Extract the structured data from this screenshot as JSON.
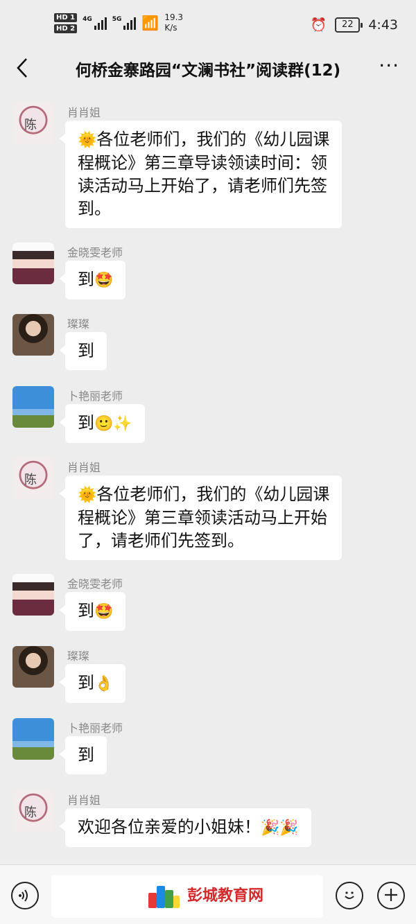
{
  "status_bar": {
    "hd1": "HD 1",
    "hd2": "HD 2",
    "sim1_label": "4G",
    "sim2_label": "5G",
    "speed_value": "19.3",
    "speed_unit": "K/s",
    "battery": "22",
    "time": "4:43"
  },
  "header": {
    "back_icon": "<",
    "title": "何桥金寨路园“文澜书社”阅读群(12)",
    "more_icon": "···"
  },
  "messages": [
    {
      "sender": "肖肖姐",
      "avatar": "xiao",
      "text": "各位老师们，我们的《幼儿园课程概论》第三章导读领读时间：领读活动马上开始了，请老师们先签到。",
      "lines": [
        "各位老师们，我们的《幼儿园课",
        "程概论》第三章导读领读时间：领",
        "读活动马上开始了，请老师们先签",
        "到。"
      ],
      "lead_emoji": "🌞",
      "trail_emoji": ""
    },
    {
      "sender": "金晓雯老师",
      "avatar": "jin",
      "lines": [
        "到"
      ],
      "lead_emoji": "",
      "trail_emoji": "🤩"
    },
    {
      "sender": "璨璨",
      "avatar": "can",
      "lines": [
        "到"
      ],
      "lead_emoji": "",
      "trail_emoji": ""
    },
    {
      "sender": "卜艳丽老师",
      "avatar": "bu",
      "lines": [
        "到"
      ],
      "lead_emoji": "",
      "trail_emoji": "🙂✨"
    },
    {
      "sender": "肖肖姐",
      "avatar": "xiao",
      "lines": [
        "各位老师们，我们的《幼儿园课",
        "程概论》第三章领读活动马上开始",
        "了，请老师们先签到。"
      ],
      "lead_emoji": "🌞",
      "trail_emoji": ""
    },
    {
      "sender": "金晓雯老师",
      "avatar": "jin",
      "lines": [
        "到"
      ],
      "lead_emoji": "",
      "trail_emoji": "🤩"
    },
    {
      "sender": "璨璨",
      "avatar": "can",
      "lines": [
        "到"
      ],
      "lead_emoji": "",
      "trail_emoji": "👌"
    },
    {
      "sender": "卜艳丽老师",
      "avatar": "bu",
      "lines": [
        "到"
      ],
      "lead_emoji": "",
      "trail_emoji": ""
    },
    {
      "sender": "肖肖姐",
      "avatar": "xiao",
      "lines": [
        "欢迎各位亲爱的小姐妹！"
      ],
      "lead_emoji": "",
      "trail_emoji": "🎉🎉"
    }
  ],
  "avatar_text": {
    "xiao": "陈"
  },
  "input_bar": {
    "voice_icon": "voice-icon",
    "emoji_icon": "emoji-icon",
    "plus_icon": "plus-icon"
  },
  "watermark": {
    "text": "彭城教育网"
  },
  "colors": {
    "background": "#ededed",
    "bubble": "#ffffff",
    "watermark_red": "#d5282b"
  }
}
